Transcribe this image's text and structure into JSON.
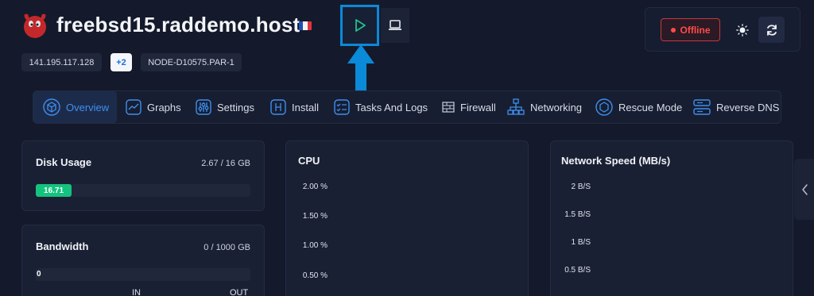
{
  "header": {
    "hostname": "freebsd15.raddemo.host",
    "flag_icon": "france-flag-icon",
    "logo_icon": "freebsd-logo-icon",
    "console_icon": "play-icon",
    "screen_icon": "laptop-icon"
  },
  "status": {
    "state": "Offline",
    "state_color": "#ff4a4a",
    "theme_icon": "sun-icon",
    "refresh_icon": "refresh-icon"
  },
  "chips": {
    "ip": "141.195.117.128",
    "extra_ips": "+2",
    "node": "NODE-D10575.PAR-1"
  },
  "nav": {
    "tabs": [
      {
        "label": "Overview",
        "icon": "cube-icon",
        "active": true
      },
      {
        "label": "Graphs",
        "icon": "graph-icon"
      },
      {
        "label": "Settings",
        "icon": "sliders-icon"
      },
      {
        "label": "Install",
        "icon": "install-icon"
      },
      {
        "label": "Tasks And Logs",
        "icon": "checklist-icon"
      },
      {
        "label": "Firewall",
        "icon": "firewall-icon"
      },
      {
        "label": "Networking",
        "icon": "network-icon"
      },
      {
        "label": "Rescue Mode",
        "icon": "rescue-icon"
      },
      {
        "label": "Reverse DNS",
        "icon": "server-icon"
      }
    ]
  },
  "disk": {
    "title": "Disk Usage",
    "value": "2.67 / 16 GB",
    "percent_label": "16.71",
    "percent": 16.71,
    "fill_color": "#13c37e"
  },
  "bandwidth": {
    "title": "Bandwidth",
    "value": "0 / 1000 GB",
    "bar_value": "0",
    "in_label": "IN",
    "out_label": "OUT"
  },
  "cpu": {
    "title": "CPU",
    "ticks": [
      "2.00 %",
      "1.50 %",
      "1.00 %",
      "0.50 %"
    ]
  },
  "network": {
    "title": "Network Speed (MB/s)",
    "ticks": [
      "2 B/S",
      "1.5 B/S",
      "1 B/S",
      "0.5 B/S"
    ]
  },
  "accent_color": "#0a8ad8"
}
